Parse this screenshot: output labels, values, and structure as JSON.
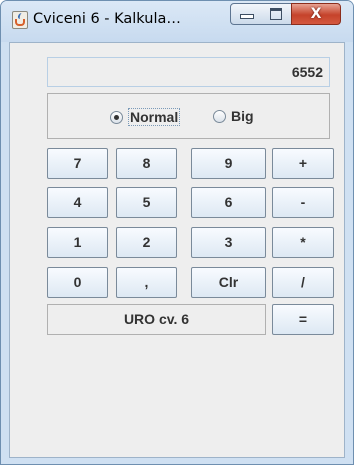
{
  "window": {
    "title": "Cviceni 6 - Kalkula…",
    "close_label": "X"
  },
  "display": {
    "value": "6552"
  },
  "mode": {
    "options": [
      {
        "label": "Normal",
        "selected": true
      },
      {
        "label": "Big",
        "selected": false
      }
    ]
  },
  "keys": [
    [
      "7",
      "8",
      "9",
      "+"
    ],
    [
      "4",
      "5",
      "6",
      "-"
    ],
    [
      "1",
      "2",
      "3",
      "*"
    ],
    [
      "0",
      ",",
      "Clr",
      "/"
    ]
  ],
  "footer": {
    "label": "URO cv. 6",
    "equals": "="
  },
  "colors": {
    "accent": "#c5432b",
    "frame": "#cfe0f2",
    "client": "#eeeeee"
  },
  "icons": {
    "app": "java-cup-icon",
    "minimize": "minimize-icon",
    "maximize": "maximize-icon",
    "close": "close-icon"
  }
}
